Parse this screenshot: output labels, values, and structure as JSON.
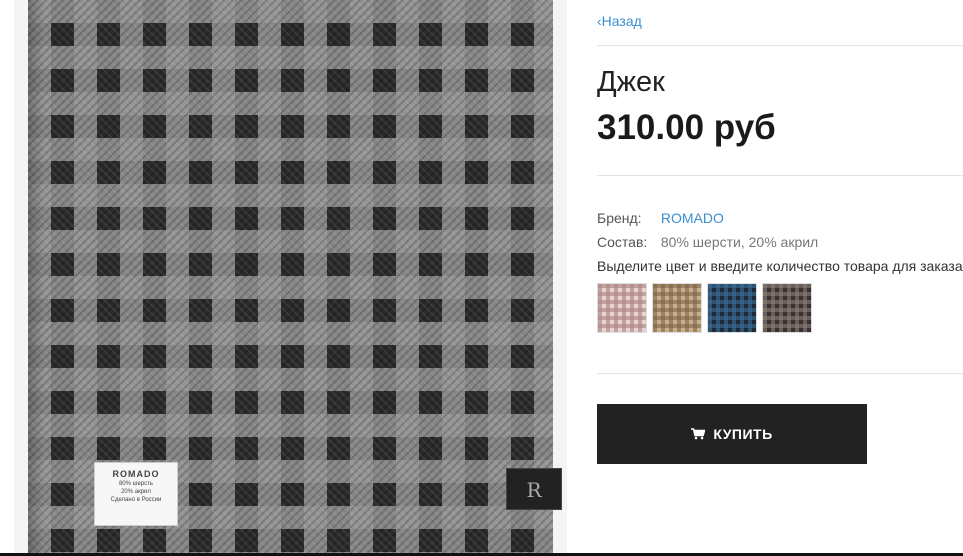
{
  "navigation": {
    "back_label": "Назад"
  },
  "product": {
    "name": "Джек",
    "price": "310.00 руб",
    "image_label": {
      "brand": "ROMADO",
      "line1": "80% шерсть",
      "line2": "20% акрил",
      "line3": "Сделано в России"
    },
    "side_tag": "R"
  },
  "attributes": {
    "brand_label": "Бренд:",
    "brand_value": "ROMADO",
    "composition_label": "Состав:",
    "composition_value": "80% шерсти, 20% акрил"
  },
  "instructions": "Выделите цвет и введите количество товара для заказа",
  "swatches": [
    {
      "name": "pink-check",
      "color": "#e6d3cf"
    },
    {
      "name": "beige-check",
      "color": "#c9b08c"
    },
    {
      "name": "navy-check",
      "color": "#1d2a3c"
    },
    {
      "name": "brown-check",
      "color": "#3a3230"
    }
  ],
  "buy_button": {
    "label": "КУПИТЬ",
    "icon": "cart-icon",
    "background": "#222222"
  },
  "colors": {
    "link": "#3b8fd1",
    "text": "#333333"
  }
}
